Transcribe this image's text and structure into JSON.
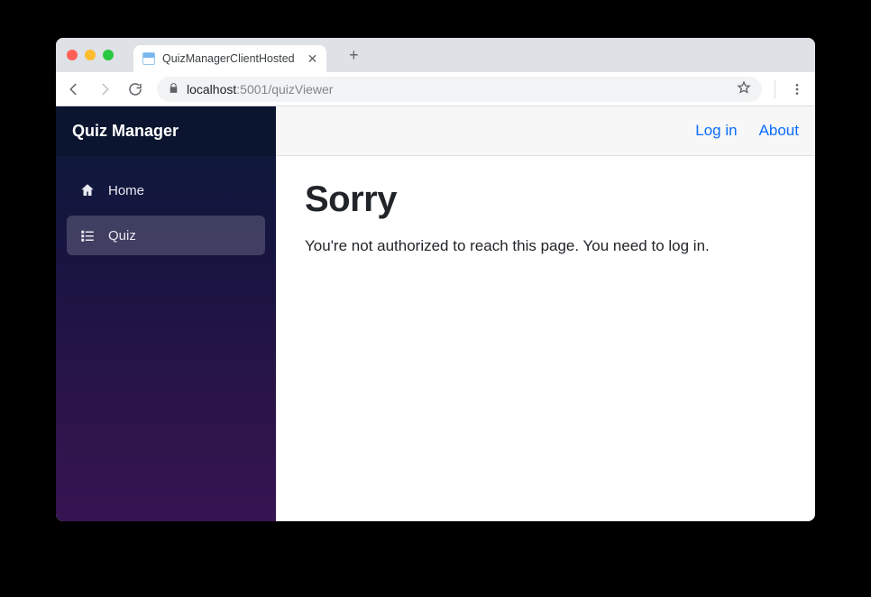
{
  "browser": {
    "tab_title": "QuizManagerClientHosted",
    "url_host_dim1": "localhost",
    "url_host_dim2": ":5001",
    "url_path": "/quizViewer"
  },
  "sidebar": {
    "brand": "Quiz Manager",
    "items": [
      {
        "label": "Home",
        "active": false
      },
      {
        "label": "Quiz",
        "active": true
      }
    ]
  },
  "topbar": {
    "links": [
      {
        "label": "Log in"
      },
      {
        "label": "About"
      }
    ]
  },
  "page": {
    "heading": "Sorry",
    "body": "You're not authorized to reach this page. You need to log in."
  }
}
